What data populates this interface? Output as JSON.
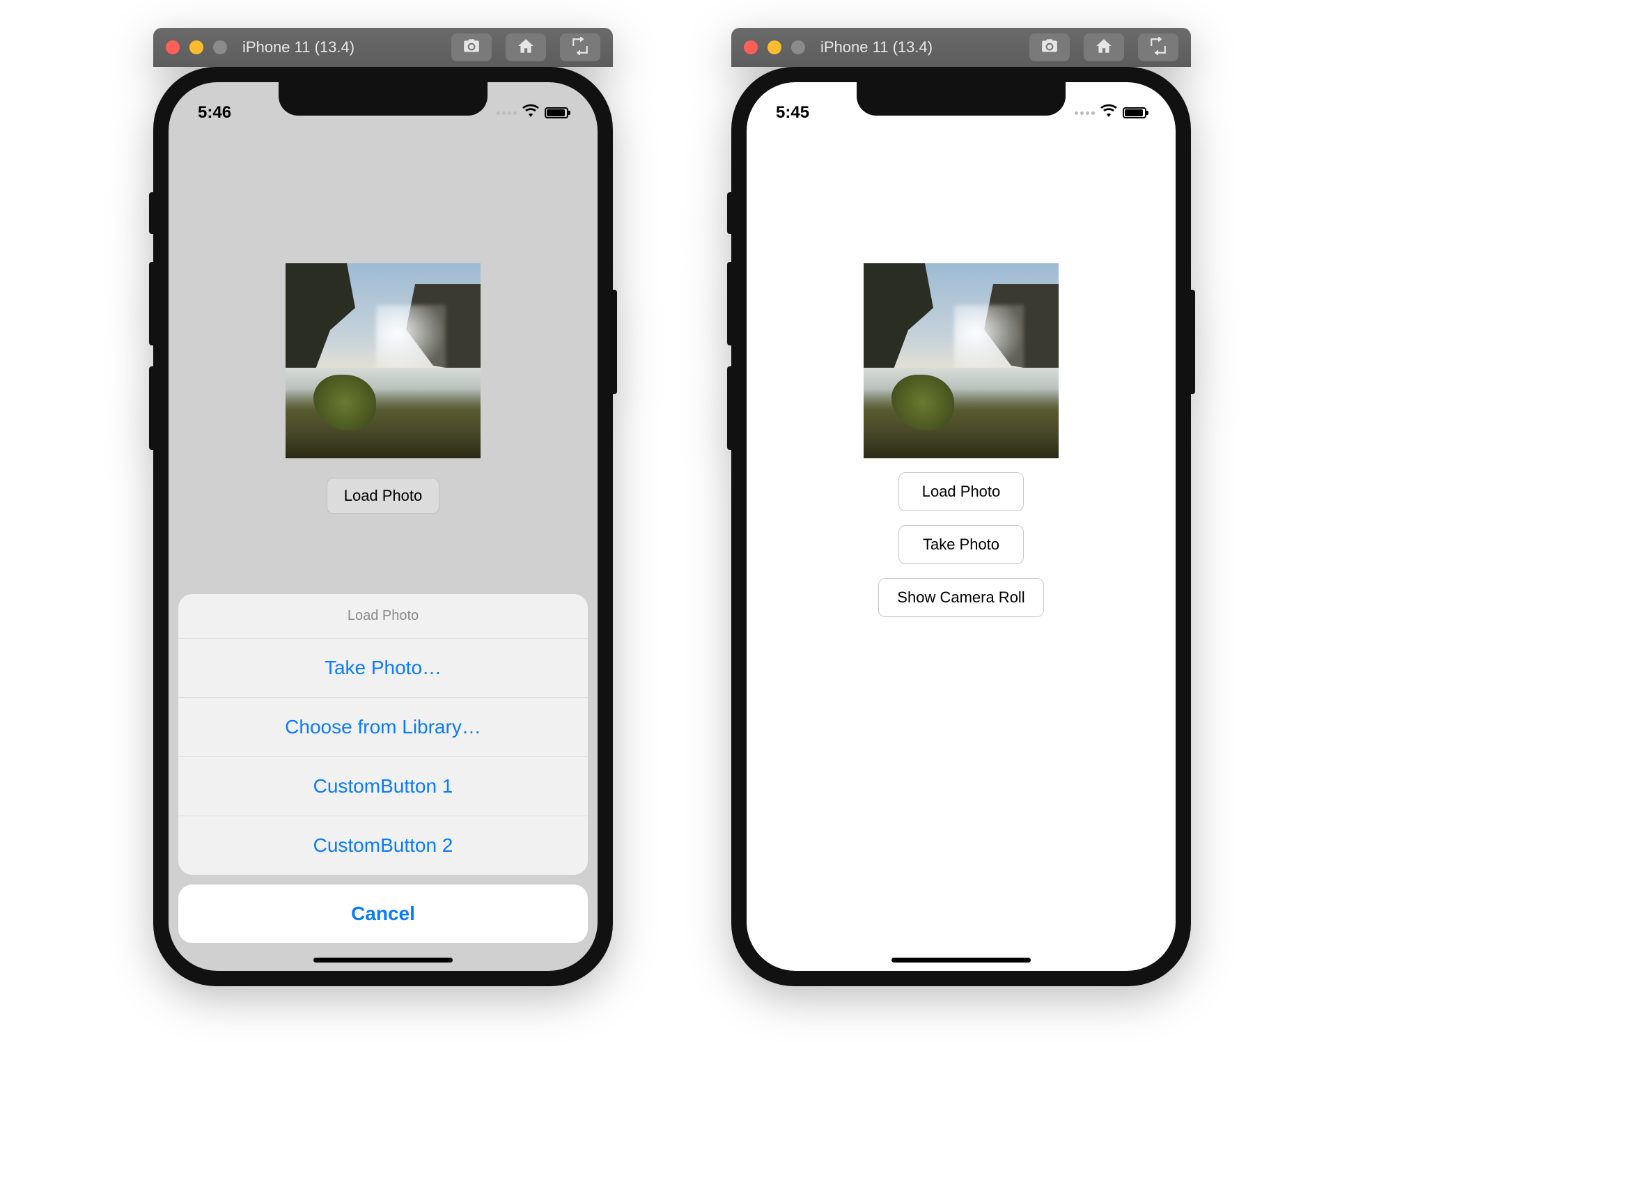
{
  "simulator": {
    "title": "iPhone 11 (13.4)",
    "toolbar": {
      "screenshot_icon": "screenshot-icon",
      "home_icon": "home-icon",
      "rotate_icon": "rotate-icon"
    }
  },
  "left": {
    "status": {
      "time": "5:46"
    },
    "app": {
      "load_button": "Load Photo"
    },
    "action_sheet": {
      "title": "Load Photo",
      "items": [
        "Take Photo…",
        "Choose from Library…",
        "CustomButton 1",
        "CustomButton 2"
      ],
      "cancel": "Cancel"
    }
  },
  "right": {
    "status": {
      "time": "5:45"
    },
    "app": {
      "buttons": [
        "Load Photo",
        "Take Photo",
        "Show Camera Roll"
      ]
    }
  }
}
